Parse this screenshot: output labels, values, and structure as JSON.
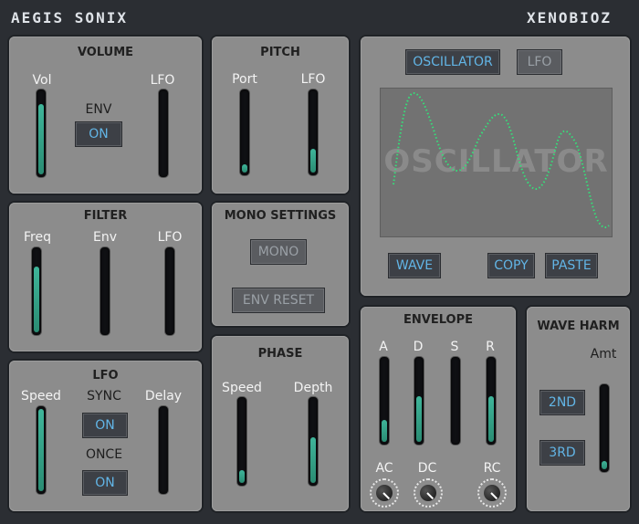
{
  "brand": {
    "left": "AEGIS SONIX",
    "right": "XENOBIOZ"
  },
  "volume": {
    "title": "VOLUME",
    "vol_label": "Vol",
    "lfo_label": "LFO",
    "env_label": "ENV",
    "env_button": "ON",
    "vol_level": 0.85,
    "lfo_level": 0.0
  },
  "pitch": {
    "title": "PITCH",
    "port_label": "Port",
    "lfo_label": "LFO",
    "port_level": 0.1,
    "lfo_level": 0.3
  },
  "oscillator": {
    "tab_oscillator": "OSCILLATOR",
    "tab_lfo": "LFO",
    "display_watermark": "OSCILLATOR",
    "wave_button": "WAVE",
    "copy_button": "COPY",
    "paste_button": "PASTE",
    "wave_color": "#34e07a"
  },
  "filter": {
    "title": "FILTER",
    "freq_label": "Freq",
    "env_label": "Env",
    "lfo_label": "LFO",
    "freq_level": 0.8,
    "env_level": 0.0,
    "lfo_level": 0.0
  },
  "mono": {
    "title": "MONO SETTINGS",
    "mono_button": "MONO",
    "env_reset_button": "ENV RESET"
  },
  "lfo": {
    "title": "LFO",
    "speed_label": "Speed",
    "sync_label": "SYNC",
    "delay_label": "Delay",
    "sync_button": "ON",
    "once_label": "ONCE",
    "once_button": "ON",
    "speed_level": 1.0,
    "delay_level": 0.0
  },
  "phase": {
    "title": "PHASE",
    "speed_label": "Speed",
    "depth_label": "Depth",
    "speed_level": 0.15,
    "depth_level": 0.55
  },
  "envelope": {
    "title": "ENVELOPE",
    "a_label": "A",
    "d_label": "D",
    "s_label": "S",
    "r_label": "R",
    "ac_label": "AC",
    "dc_label": "DC",
    "rc_label": "RC",
    "a_level": 0.27,
    "d_level": 0.55,
    "s_level": 0.0,
    "r_level": 0.55
  },
  "wave_harm": {
    "title": "WAVE HARM",
    "amt_label": "Amt",
    "btn_2nd": "2ND",
    "btn_3rd": "3RD",
    "amt_level": 0.1
  },
  "colors": {
    "background": "#2b2e33",
    "panel": "#8c8c8c",
    "accent": "#62b5e6",
    "slider_fill": "#3fb59a"
  }
}
